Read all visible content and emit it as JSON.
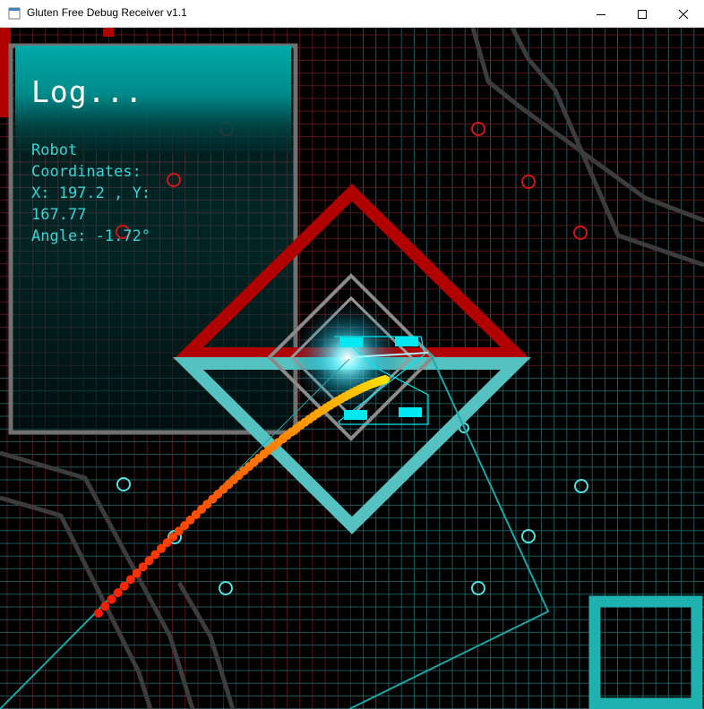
{
  "window": {
    "title": "Gluten Free Debug Receiver v1.1",
    "controls": {
      "minimize": "minimize",
      "maximize": "maximize",
      "close": "close"
    }
  },
  "log": {
    "title": "Log...",
    "lines": [
      "Robot",
      "Coordinates:",
      "X: 197.2 , Y:",
      "167.77",
      "Angle: -1.72°"
    ]
  },
  "colors": {
    "background": "#000000",
    "grid_red": "#6b1a22",
    "grid_cyan": "#1f6f70",
    "red_alliance": "#b00000",
    "blue_alliance": "#55c1c1",
    "path_start": "#ff1a00",
    "path_end": "#ffe000",
    "robot_marker": "#00e8f0"
  },
  "icons": {
    "app": "app-icon"
  }
}
